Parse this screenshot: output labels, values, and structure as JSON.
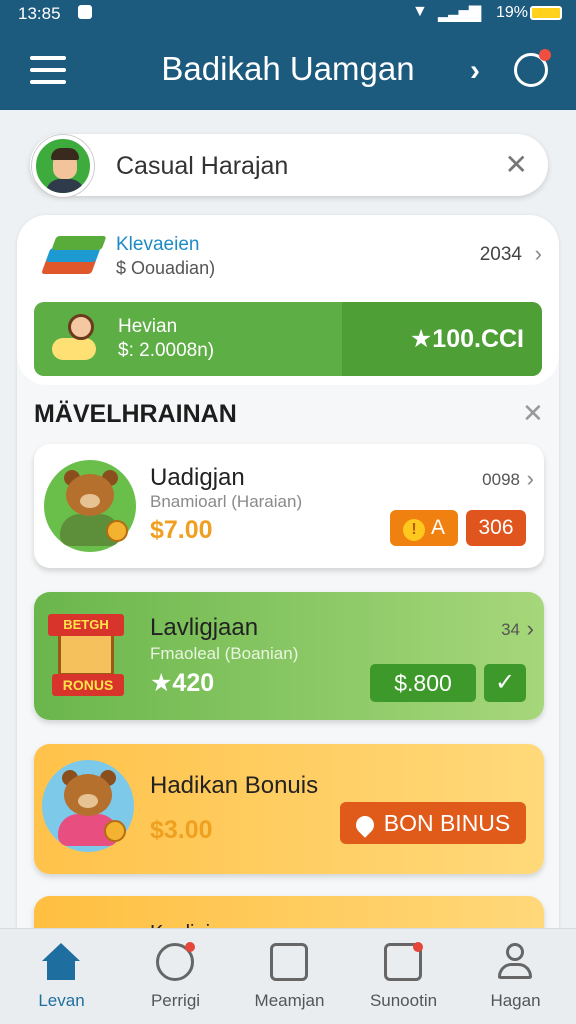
{
  "status": {
    "time": "13:85",
    "battery": "19%"
  },
  "header": {
    "title": "Badikah Uamgan"
  },
  "user": {
    "name": "Casual Harajan"
  },
  "balance": {
    "label": "Klevaeien",
    "sub": "$ Oouadian)",
    "value": "2034"
  },
  "promo": {
    "label": "Hevian",
    "sub": "$: 2.0008n)",
    "reward": "★100.CCI"
  },
  "section": {
    "title": "MÄVELHRAINAN"
  },
  "cards": [
    {
      "title": "Uadigjan",
      "sub": "Bnamioarl (Haraian)",
      "price": "$7.00",
      "value": "0098",
      "pill_a": "A",
      "pill_b": "306"
    },
    {
      "title": "Lavligjaan",
      "sub": "Fmaoleal (Boanian)",
      "price": "★420",
      "value": "34",
      "pill_c": "$.800",
      "pill_d": "✓",
      "badge_top": "BETGH",
      "badge_bottom": "RONUS"
    },
    {
      "title": "Hadikan Bonuis",
      "price": "$3.00",
      "pill_e": "BON BINUS"
    },
    {
      "title": "Kauljnjan"
    }
  ],
  "nav": [
    {
      "label": "Levan",
      "icon": "home-icon"
    },
    {
      "label": "Perrigi",
      "icon": "stopwatch-icon"
    },
    {
      "label": "Meamjan",
      "icon": "document-icon"
    },
    {
      "label": "Sunootin",
      "icon": "monitor-icon"
    },
    {
      "label": "Hagan",
      "icon": "person-icon"
    }
  ],
  "colors": {
    "header": "#1c5a7e",
    "green": "#5dae45",
    "orange": "#e05a1a",
    "nav_active": "#1e6fa0"
  }
}
